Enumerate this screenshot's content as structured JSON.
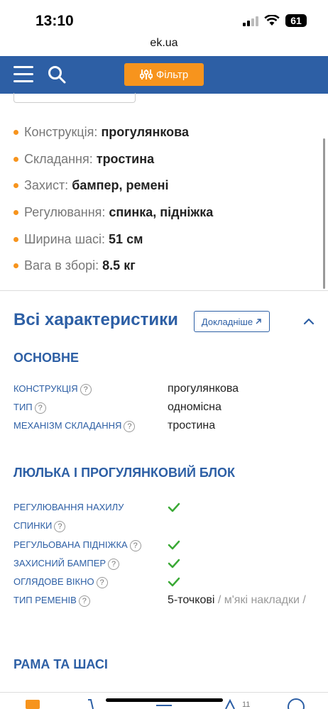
{
  "status": {
    "time": "13:10",
    "battery": "61"
  },
  "browser": {
    "url": "ek.ua"
  },
  "header": {
    "filter_label": "Фільтр"
  },
  "summary": [
    {
      "key": "Конструкція:",
      "value": "прогулянкова"
    },
    {
      "key": "Складання:",
      "value": "тростина"
    },
    {
      "key": "Захист:",
      "value": "бампер, ремені"
    },
    {
      "key": "Регулювання:",
      "value": "спинка, підніжка"
    },
    {
      "key": "Ширина шасі:",
      "value": "51 см"
    },
    {
      "key": "Вага в зборі:",
      "value": "8.5 кг"
    }
  ],
  "all_specs": {
    "title": "Всі характеристики",
    "more_label": "Докладніше"
  },
  "sections": {
    "basic": {
      "title": "ОСНОВНЕ",
      "rows": [
        {
          "key": "КОНСТРУКЦІЯ",
          "value": "прогулянкова"
        },
        {
          "key": "ТИП",
          "value": "одномісна"
        },
        {
          "key": "МЕХАНІЗМ СКЛАДАННЯ",
          "value": "тростина"
        }
      ]
    },
    "cradle": {
      "title": "ЛЮЛЬКА І ПРОГУЛЯНКОВИЙ БЛОК",
      "rows": [
        {
          "key_line1": "РЕГУЛЮВАННЯ НАХИЛУ",
          "key_line2": "СПИНКИ"
        },
        {
          "key": "РЕГУЛЬОВАНА ПІДНІЖКА"
        },
        {
          "key": "ЗАХИСНИЙ БАМПЕР"
        },
        {
          "key": "ОГЛЯДОВЕ ВІКНО"
        },
        {
          "key": "ТИП РЕМЕНІВ",
          "value_main": "5-точкові",
          "value_sep": " / ",
          "value_extra": "м'які накладки /"
        }
      ]
    },
    "frame": {
      "title": "РАМА ТА ШАСІ"
    }
  },
  "bottom_nav": {
    "badge": "11"
  },
  "colors": {
    "brand_blue": "#2d5fa5",
    "accent_orange": "#f7941d",
    "check_green": "#3aa935"
  }
}
